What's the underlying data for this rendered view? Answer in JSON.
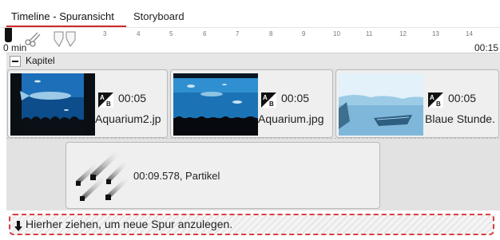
{
  "tabs": [
    {
      "label": "Timeline - Spuransicht",
      "active": true
    },
    {
      "label": "Storyboard",
      "active": false
    }
  ],
  "ruler": {
    "start_label": "0 min",
    "end_label": "00:15",
    "tick_numbers": [
      "3",
      "4",
      "5",
      "6",
      "7",
      "8",
      "9",
      "10",
      "11",
      "12",
      "13",
      "14"
    ]
  },
  "track": {
    "title": "Kapitel"
  },
  "clips": [
    {
      "duration": "00:05",
      "name": "Aquarium2.jp"
    },
    {
      "duration": "00:05",
      "name": "Aquarium.jpg"
    },
    {
      "duration": "00:05",
      "name": "Blaue Stunde."
    }
  ],
  "effect_clip": {
    "label": "00:09.578, Partikel"
  },
  "dropzone": {
    "text": "Hierher ziehen, um neue Spur anzulegen."
  },
  "colors": {
    "accent": "#d0282c",
    "dropzone_border": "#dc3d3d"
  }
}
